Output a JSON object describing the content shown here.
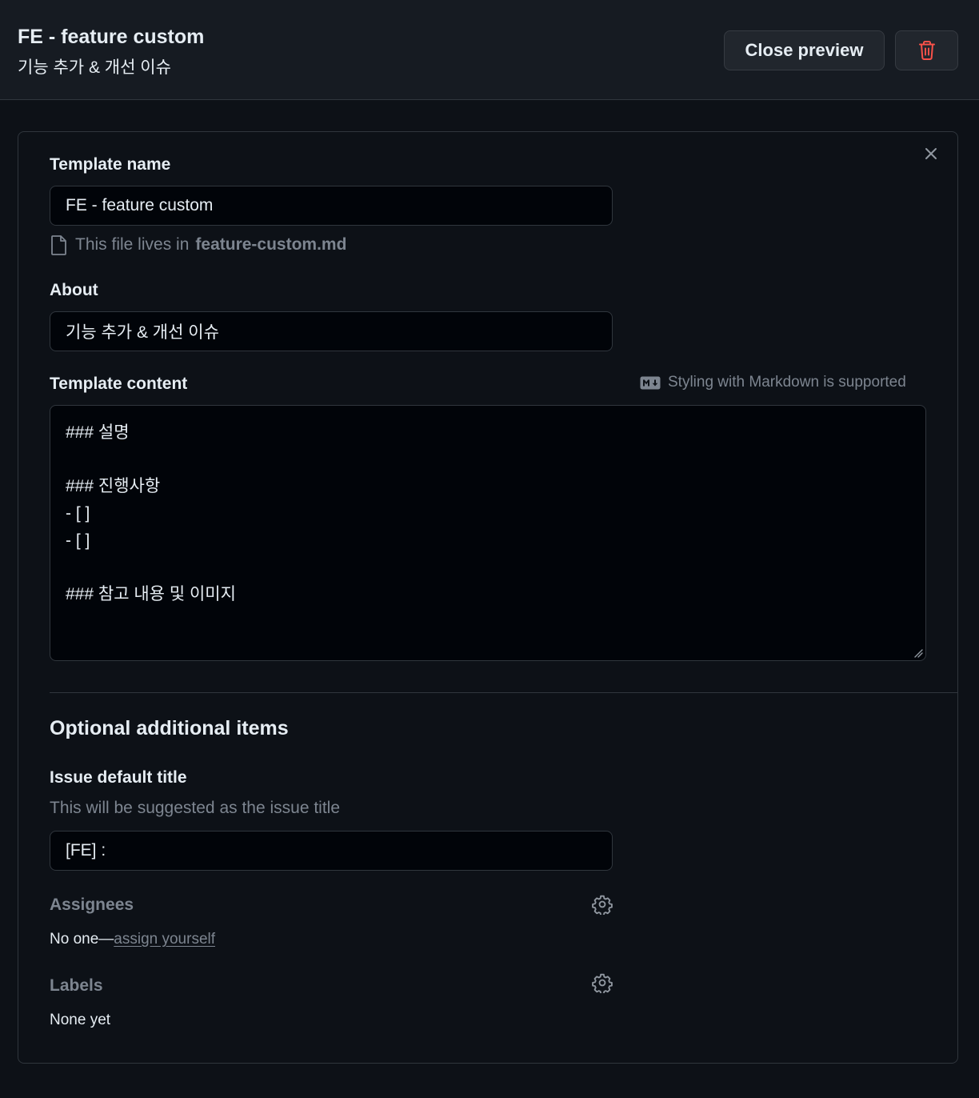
{
  "header": {
    "title": "FE - feature custom",
    "subtitle": "기능 추가 & 개선 이슈",
    "close_preview_label": "Close preview",
    "delete_icon": "trash-icon",
    "delete_color": "#f85149"
  },
  "form": {
    "close_icon": "x-icon",
    "template_name_label": "Template name",
    "template_name_value": "FE - feature custom",
    "file_note_prefix": "This file lives in",
    "file_note_filename": "feature-custom.md",
    "about_label": "About",
    "about_value": "기능 추가 & 개선 이슈",
    "content_label": "Template content",
    "markdown_hint": "Styling with Markdown is supported",
    "content_lines": [
      "### 설명",
      "",
      "### 진행사항",
      "- [ ]",
      "- [ ]",
      "",
      "### 참고 내용 및 이미지"
    ]
  },
  "optional": {
    "section_title": "Optional additional items",
    "issue_title_label": "Issue default title",
    "issue_title_desc": "This will be suggested as the issue title",
    "issue_title_value": "[FE] :",
    "assignees_label": "Assignees",
    "assignees_prefix": "No one—",
    "assignees_link": "assign yourself",
    "labels_label": "Labels",
    "labels_value": "None yet"
  }
}
